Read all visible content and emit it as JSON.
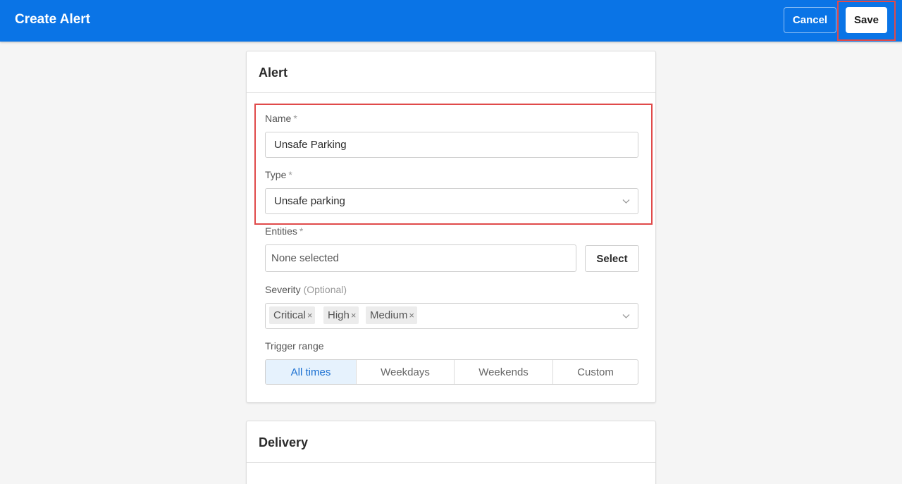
{
  "header": {
    "title": "Create Alert",
    "cancel_label": "Cancel",
    "save_label": "Save"
  },
  "alert_card": {
    "title": "Alert",
    "name": {
      "label": "Name",
      "required": "*",
      "value": "Unsafe Parking"
    },
    "type": {
      "label": "Type",
      "required": "*",
      "value": "Unsafe parking"
    },
    "entities": {
      "label": "Entities",
      "required": "*",
      "value": "None selected",
      "select_label": "Select"
    },
    "severity": {
      "label": "Severity",
      "optional": "(Optional)",
      "tags": [
        "Critical",
        "High",
        "Medium"
      ],
      "remove_glyph": "×"
    },
    "trigger_range": {
      "label": "Trigger range",
      "options": [
        "All times",
        "Weekdays",
        "Weekends",
        "Custom"
      ],
      "selected": "All times"
    }
  },
  "delivery_card": {
    "title": "Delivery"
  },
  "colors": {
    "brand": "#0a74e6",
    "highlight": "#e04a4a",
    "active_segment_bg": "#e6f2fd",
    "active_segment_text": "#1a6fd1"
  },
  "icons": {
    "dropdown": "chevron-down-icon",
    "remove_tag": "close-icon"
  }
}
